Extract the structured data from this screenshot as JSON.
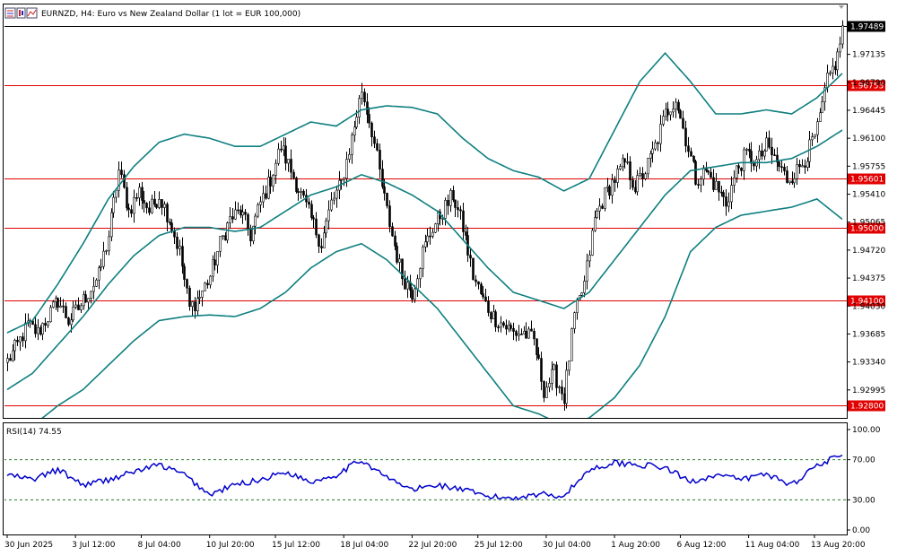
{
  "window": {
    "title": "EURNZD, H4:  Euro vs New Zealand Dollar (1 lot = EUR 100,000)",
    "toolbar_icons": [
      "chart-bars-icon",
      "chart-candles-icon",
      "chart-line-icon"
    ]
  },
  "colors": {
    "candle": "#000000",
    "bands": "#0f7f7f",
    "hline": "#e00000",
    "current_price_box": "#000000",
    "rsi": "#0000cc",
    "grid": "#000000"
  },
  "chart_data": [
    {
      "type": "candlestick",
      "symbol": "EURNZD",
      "timeframe": "H4",
      "ylim": [
        1.9265,
        1.9775
      ],
      "y_ticks": [
        "1.97489",
        "1.97135",
        "1.96790",
        "1.96445",
        "1.96100",
        "1.95755",
        "1.95410",
        "1.95065",
        "1.94720",
        "1.94375",
        "1.94030",
        "1.93685",
        "1.93340",
        "1.92995"
      ],
      "x_ticks": [
        "30 Jun 2025",
        "3 Jul 12:00",
        "8 Jul 04:00",
        "10 Jul 20:00",
        "15 Jul 12:00",
        "18 Jul 04:00",
        "22 Jul 20:00",
        "25 Jul 12:00",
        "30 Jul 04:00",
        "1 Aug 20:00",
        "6 Aug 12:00",
        "11 Aug 04:00",
        "13 Aug 20:00"
      ],
      "indicator": "Bollinger Bands",
      "last_price": "1.97489",
      "horizontal_levels": [
        {
          "value": 1.96753,
          "label": "1.96753"
        },
        {
          "value": 1.95601,
          "label": "1.95601"
        },
        {
          "value": 1.95,
          "label": "1.95000"
        },
        {
          "value": 1.941,
          "label": "1.94100"
        },
        {
          "value": 1.928,
          "label": "1.92800"
        }
      ],
      "close_path": [
        [
          0,
          1.9335
        ],
        [
          4,
          1.9355
        ],
        [
          8,
          1.938
        ],
        [
          12,
          1.937
        ],
        [
          16,
          1.939
        ],
        [
          20,
          1.941
        ],
        [
          24,
          1.9385
        ],
        [
          28,
          1.94
        ],
        [
          32,
          1.942
        ],
        [
          36,
          1.944
        ],
        [
          40,
          1.949
        ],
        [
          44,
          1.957
        ],
        [
          48,
          1.952
        ],
        [
          52,
          1.9545
        ],
        [
          56,
          1.952
        ],
        [
          60,
          1.954
        ],
        [
          64,
          1.951
        ],
        [
          68,
          1.947
        ],
        [
          72,
          1.94
        ],
        [
          76,
          1.9415
        ],
        [
          80,
          1.944
        ],
        [
          84,
          1.948
        ],
        [
          88,
          1.951
        ],
        [
          92,
          1.952
        ],
        [
          96,
          1.949
        ],
        [
          100,
          1.953
        ],
        [
          104,
          1.956
        ],
        [
          108,
          1.96
        ],
        [
          112,
          1.957
        ],
        [
          116,
          1.954
        ],
        [
          120,
          1.951
        ],
        [
          124,
          1.948
        ],
        [
          128,
          1.953
        ],
        [
          132,
          1.9555
        ],
        [
          136,
          1.961
        ],
        [
          140,
          1.967
        ],
        [
          144,
          1.962
        ],
        [
          148,
          1.955
        ],
        [
          152,
          1.949
        ],
        [
          156,
          1.944
        ],
        [
          160,
          1.942
        ],
        [
          164,
          1.947
        ],
        [
          168,
          1.95
        ],
        [
          172,
          1.952
        ],
        [
          176,
          1.954
        ],
        [
          180,
          1.95
        ],
        [
          184,
          1.944
        ],
        [
          188,
          1.941
        ],
        [
          192,
          1.939
        ],
        [
          196,
          1.938
        ],
        [
          200,
          1.937
        ],
        [
          204,
          1.937
        ],
        [
          208,
          1.936
        ],
        [
          212,
          1.93
        ],
        [
          216,
          1.932
        ],
        [
          220,
          1.929
        ],
        [
          224,
          1.939
        ],
        [
          228,
          1.943
        ],
        [
          232,
          1.951
        ],
        [
          236,
          1.954
        ],
        [
          240,
          1.956
        ],
        [
          244,
          1.958
        ],
        [
          248,
          1.955
        ],
        [
          252,
          1.957
        ],
        [
          256,
          1.96
        ],
        [
          260,
          1.964
        ],
        [
          264,
          1.966
        ],
        [
          268,
          1.961
        ],
        [
          272,
          1.956
        ],
        [
          276,
          1.957
        ],
        [
          280,
          1.955
        ],
        [
          284,
          1.953
        ],
        [
          288,
          1.957
        ],
        [
          292,
          1.959
        ],
        [
          296,
          1.958
        ],
        [
          300,
          1.96
        ],
        [
          304,
          1.958
        ],
        [
          308,
          1.956
        ],
        [
          312,
          1.957
        ],
        [
          316,
          1.959
        ],
        [
          320,
          1.962
        ],
        [
          324,
          1.968
        ],
        [
          328,
          1.971
        ],
        [
          330,
          1.97489
        ]
      ],
      "bb_upper_path": [
        [
          0,
          1.937
        ],
        [
          10,
          1.9385
        ],
        [
          20,
          1.943
        ],
        [
          30,
          1.948
        ],
        [
          40,
          1.9535
        ],
        [
          50,
          1.9575
        ],
        [
          60,
          1.9605
        ],
        [
          70,
          1.9615
        ],
        [
          80,
          1.961
        ],
        [
          90,
          1.96
        ],
        [
          100,
          1.96
        ],
        [
          110,
          1.9615
        ],
        [
          120,
          1.963
        ],
        [
          130,
          1.9625
        ],
        [
          140,
          1.9645
        ],
        [
          150,
          1.965
        ],
        [
          160,
          1.9648
        ],
        [
          170,
          1.964
        ],
        [
          180,
          1.961
        ],
        [
          190,
          1.9585
        ],
        [
          200,
          1.957
        ],
        [
          210,
          1.9562
        ],
        [
          220,
          1.9545
        ],
        [
          230,
          1.956
        ],
        [
          240,
          1.962
        ],
        [
          250,
          1.968
        ],
        [
          260,
          1.9715
        ],
        [
          270,
          1.968
        ],
        [
          280,
          1.964
        ],
        [
          290,
          1.964
        ],
        [
          300,
          1.9645
        ],
        [
          310,
          1.964
        ],
        [
          320,
          1.966
        ],
        [
          330,
          1.969
        ]
      ],
      "bb_middle_path": [
        [
          0,
          1.93
        ],
        [
          10,
          1.932
        ],
        [
          20,
          1.9355
        ],
        [
          30,
          1.939
        ],
        [
          40,
          1.943
        ],
        [
          50,
          1.9465
        ],
        [
          60,
          1.949
        ],
        [
          70,
          1.95
        ],
        [
          80,
          1.95
        ],
        [
          90,
          1.9495
        ],
        [
          100,
          1.95
        ],
        [
          110,
          1.952
        ],
        [
          120,
          1.954
        ],
        [
          130,
          1.955
        ],
        [
          140,
          1.9565
        ],
        [
          150,
          1.9555
        ],
        [
          160,
          1.954
        ],
        [
          170,
          1.952
        ],
        [
          180,
          1.9485
        ],
        [
          190,
          1.945
        ],
        [
          200,
          1.942
        ],
        [
          210,
          1.941
        ],
        [
          220,
          1.94
        ],
        [
          230,
          1.942
        ],
        [
          240,
          1.946
        ],
        [
          250,
          1.95
        ],
        [
          260,
          1.954
        ],
        [
          270,
          1.957
        ],
        [
          280,
          1.9575
        ],
        [
          290,
          1.958
        ],
        [
          300,
          1.958
        ],
        [
          310,
          1.9585
        ],
        [
          320,
          1.96
        ],
        [
          330,
          1.962
        ]
      ],
      "bb_lower_path": [
        [
          0,
          1.923
        ],
        [
          10,
          1.9255
        ],
        [
          20,
          1.928
        ],
        [
          30,
          1.93
        ],
        [
          40,
          1.933
        ],
        [
          50,
          1.936
        ],
        [
          60,
          1.9385
        ],
        [
          70,
          1.939
        ],
        [
          80,
          1.9392
        ],
        [
          90,
          1.939
        ],
        [
          100,
          1.94
        ],
        [
          110,
          1.942
        ],
        [
          120,
          1.945
        ],
        [
          130,
          1.947
        ],
        [
          140,
          1.948
        ],
        [
          150,
          1.946
        ],
        [
          160,
          1.943
        ],
        [
          170,
          1.94
        ],
        [
          180,
          1.936
        ],
        [
          190,
          1.932
        ],
        [
          200,
          1.928
        ],
        [
          210,
          1.927
        ],
        [
          220,
          1.9255
        ],
        [
          230,
          1.9265
        ],
        [
          240,
          1.929
        ],
        [
          250,
          1.933
        ],
        [
          260,
          1.939
        ],
        [
          270,
          1.947
        ],
        [
          280,
          1.95
        ],
        [
          290,
          1.9515
        ],
        [
          300,
          1.952
        ],
        [
          310,
          1.9525
        ],
        [
          320,
          1.9535
        ],
        [
          330,
          1.951
        ]
      ]
    },
    {
      "type": "line",
      "label": "RSI(14) 74.55",
      "ylim": [
        0,
        100
      ],
      "y_ticks": [
        "100.00",
        "70.00",
        "30.00",
        "0.00"
      ],
      "levels": [
        70,
        30
      ],
      "values_path": [
        [
          0,
          55
        ],
        [
          10,
          50
        ],
        [
          20,
          60
        ],
        [
          30,
          45
        ],
        [
          40,
          50
        ],
        [
          50,
          58
        ],
        [
          60,
          65
        ],
        [
          70,
          55
        ],
        [
          80,
          35
        ],
        [
          90,
          45
        ],
        [
          100,
          50
        ],
        [
          110,
          58
        ],
        [
          120,
          48
        ],
        [
          130,
          55
        ],
        [
          140,
          70
        ],
        [
          150,
          52
        ],
        [
          160,
          40
        ],
        [
          170,
          45
        ],
        [
          180,
          40
        ],
        [
          190,
          33
        ],
        [
          200,
          32
        ],
        [
          210,
          36
        ],
        [
          220,
          34
        ],
        [
          230,
          60
        ],
        [
          240,
          67
        ],
        [
          250,
          65
        ],
        [
          260,
          62
        ],
        [
          270,
          48
        ],
        [
          280,
          55
        ],
        [
          290,
          50
        ],
        [
          300,
          56
        ],
        [
          310,
          45
        ],
        [
          320,
          65
        ],
        [
          330,
          74.55
        ]
      ]
    }
  ]
}
